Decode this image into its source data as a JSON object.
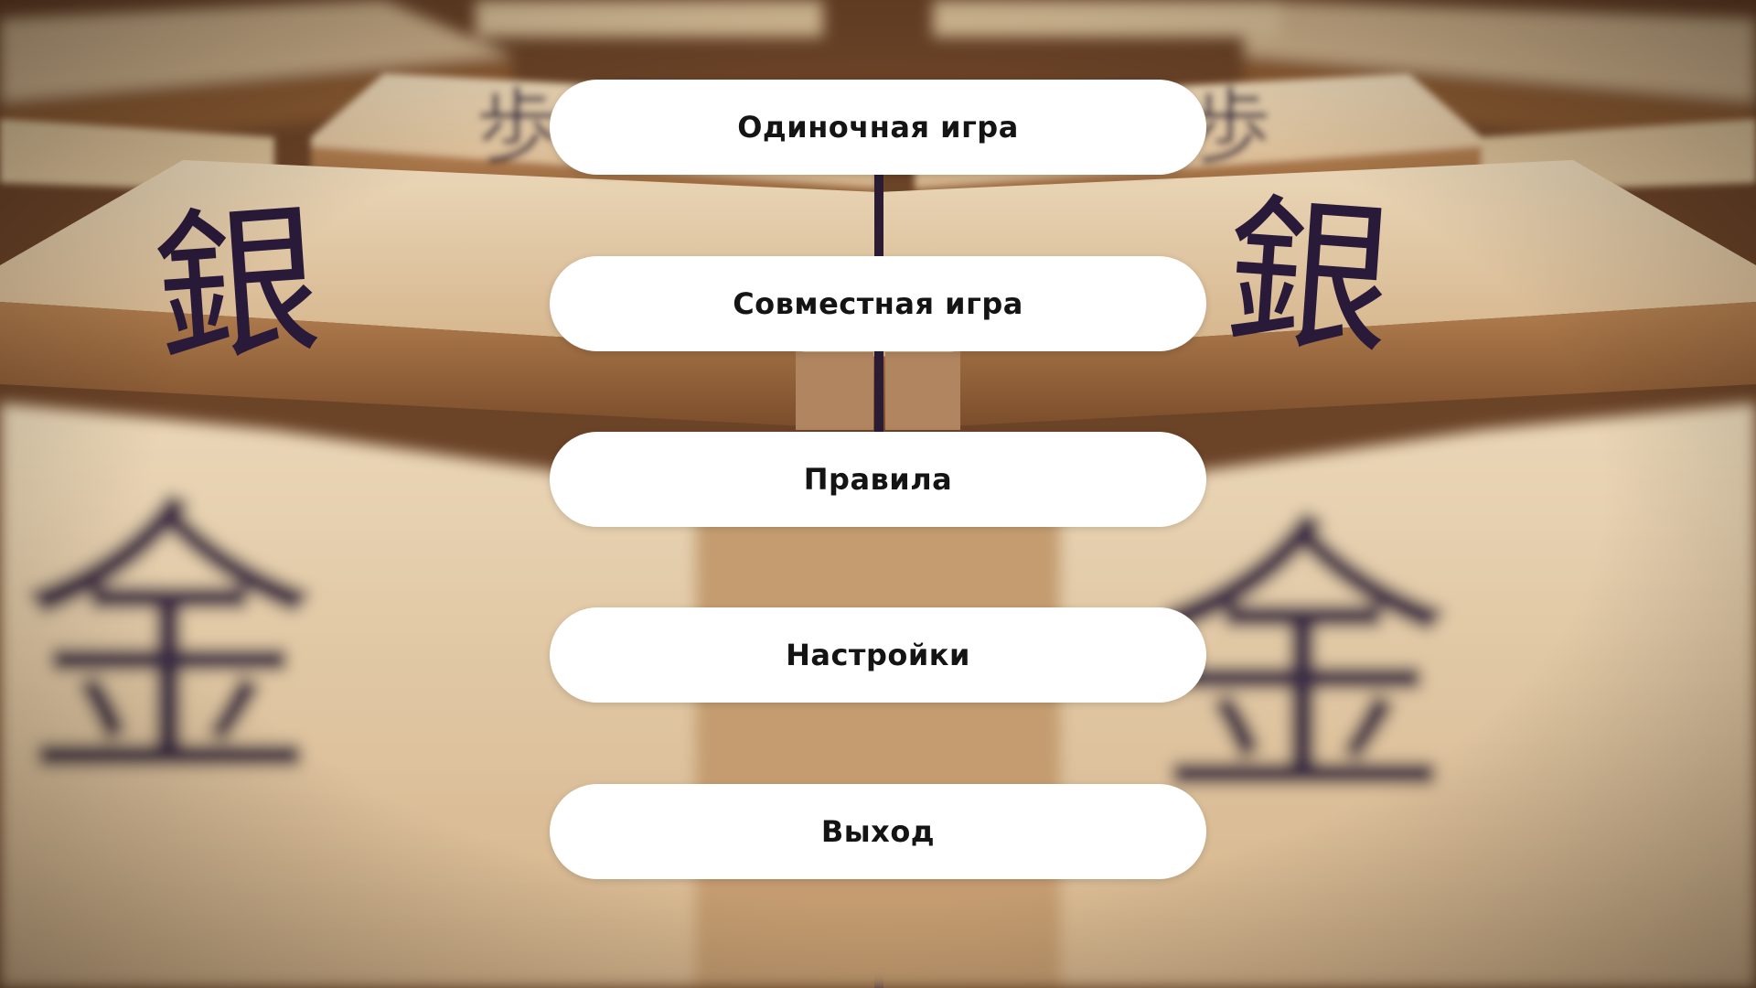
{
  "background": {
    "icon": "shogi-pieces-background",
    "description_colors": {
      "wood_light": "#e6cfae",
      "wood_mid": "#b98b5e",
      "wood_dark": "#6b4327",
      "ink": "#2a1a3a"
    }
  },
  "menu": {
    "items": [
      {
        "label": "Одиночная игра"
      },
      {
        "label": "Совместная игра"
      },
      {
        "label": "Правила"
      },
      {
        "label": "Настройки"
      },
      {
        "label": "Выход"
      }
    ]
  },
  "colors": {
    "button_bg": "#ffffff",
    "button_text": "#141414"
  }
}
